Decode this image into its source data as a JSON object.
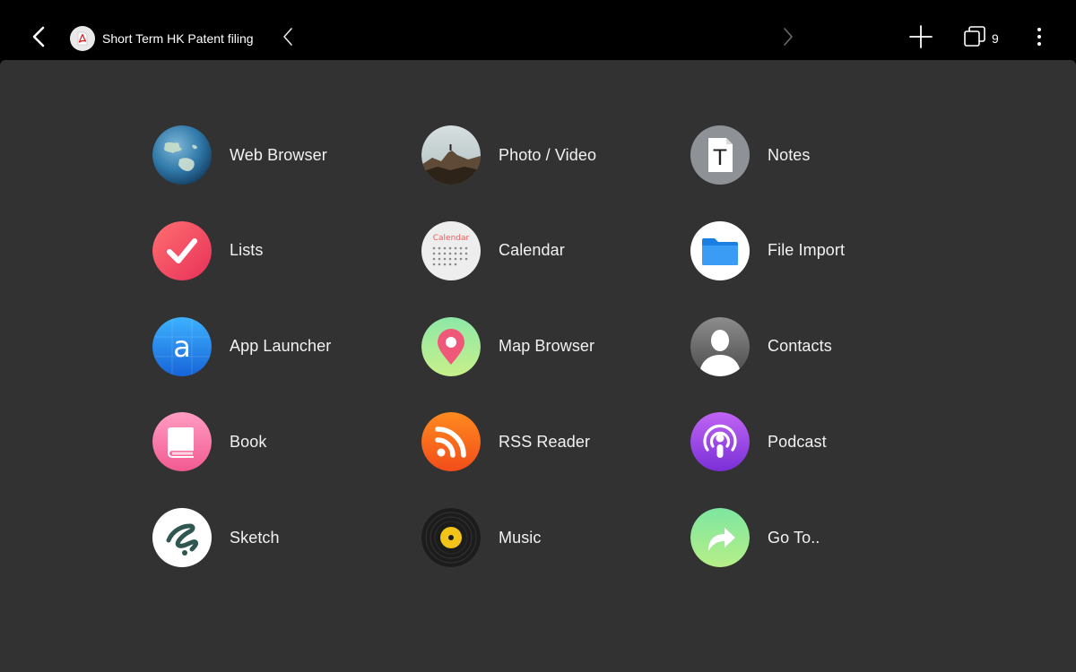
{
  "topbar": {
    "tab_title": "Short Term HK Patent filing",
    "tab_count": "9",
    "icons": [
      "back-icon",
      "pdf-icon",
      "previous-icon",
      "next-icon",
      "plus-icon",
      "tabs-icon",
      "more-icon"
    ]
  },
  "apps": [
    {
      "label": "Web Browser",
      "icon": "globe-icon"
    },
    {
      "label": "Photo / Video",
      "icon": "photo-icon"
    },
    {
      "label": "Notes",
      "icon": "notes-icon",
      "glyph": "T"
    },
    {
      "label": "Lists",
      "icon": "checkmark-icon"
    },
    {
      "label": "Calendar",
      "icon": "calendar-icon",
      "glyph": "Calendar"
    },
    {
      "label": "File Import",
      "icon": "folder-icon"
    },
    {
      "label": "App Launcher",
      "icon": "app-launcher-icon",
      "glyph": "a"
    },
    {
      "label": "Map Browser",
      "icon": "map-pin-icon"
    },
    {
      "label": "Contacts",
      "icon": "contact-icon"
    },
    {
      "label": "Book",
      "icon": "book-icon"
    },
    {
      "label": "RSS Reader",
      "icon": "rss-icon"
    },
    {
      "label": "Podcast",
      "icon": "podcast-icon"
    },
    {
      "label": "Sketch",
      "icon": "sketch-icon"
    },
    {
      "label": "Music",
      "icon": "vinyl-record-icon"
    },
    {
      "label": "Go To..",
      "icon": "go-to-arrow-icon"
    }
  ],
  "colors": {
    "topbar": "#000000",
    "panel": "#323232",
    "text": "#f2f2f2"
  }
}
